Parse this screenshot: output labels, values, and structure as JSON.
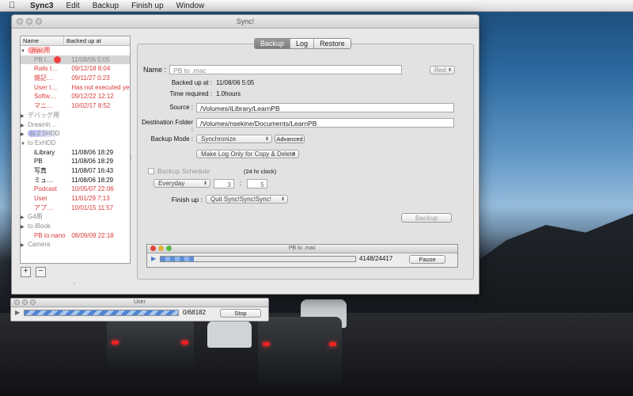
{
  "menubar": {
    "app": "Sync3",
    "items": [
      "Edit",
      "Backup",
      "Finish up",
      "Window"
    ]
  },
  "window": {
    "title": "Sync!"
  },
  "list": {
    "columns": [
      "Name",
      "Backed up at"
    ],
    "rows": [
      {
        "name": ".mac用",
        "date": "",
        "group": true,
        "expanded": true,
        "style": "red",
        "hl": "red"
      },
      {
        "name": "PB t…",
        "date": "11/08/06 5:05",
        "style": "gray",
        "sel": true,
        "dot": true
      },
      {
        "name": "Rails t…",
        "date": "09/12/18 8:04",
        "style": "red"
      },
      {
        "name": "雑記…",
        "date": "09/11/27 0:23",
        "style": "red"
      },
      {
        "name": "User t…",
        "date": "Has not executed yet",
        "style": "red"
      },
      {
        "name": "Softw…",
        "date": "09/12/22 12:12",
        "style": "red"
      },
      {
        "name": "マニ…",
        "date": "10/02/17 8:52",
        "style": "red"
      },
      {
        "name": "デバッグ用",
        "date": "",
        "group": true,
        "expanded": false,
        "style": "gray"
      },
      {
        "name": "Dreamh…",
        "date": "",
        "group": true,
        "expanded": false,
        "style": "gray"
      },
      {
        "name": "to 2.5HDD",
        "date": "",
        "group": true,
        "expanded": false,
        "style": "gray",
        "hl": "blue"
      },
      {
        "name": "to ExHDD",
        "date": "",
        "group": true,
        "expanded": true,
        "style": "gray"
      },
      {
        "name": "iLibrary",
        "date": "11/08/06 18:29",
        "style": "dark"
      },
      {
        "name": "PB",
        "date": "11/08/06 18:29",
        "style": "dark"
      },
      {
        "name": "写真",
        "date": "11/08/07 16:43",
        "style": "dark"
      },
      {
        "name": "ミュ…",
        "date": "11/08/06 18:29",
        "style": "dark"
      },
      {
        "name": "Podcast",
        "date": "10/05/07 22:06",
        "style": "red"
      },
      {
        "name": "User",
        "date": "11/01/29 7:13",
        "style": "red"
      },
      {
        "name": "アプ…",
        "date": "10/01/15 11:57",
        "style": "red"
      },
      {
        "name": "G4用",
        "date": "",
        "group": true,
        "expanded": false,
        "style": "gray"
      },
      {
        "name": "to iBook",
        "date": "",
        "group": true,
        "expanded": false,
        "style": "gray"
      },
      {
        "name": "PB to nano",
        "date": "08/09/09 22:18",
        "style": "red"
      },
      {
        "name": "Camera",
        "date": "",
        "group": true,
        "expanded": false,
        "style": "gray"
      }
    ],
    "add_label": "+",
    "remove_label": "−"
  },
  "tabs": [
    {
      "label": "Backup",
      "active": true
    },
    {
      "label": "Log"
    },
    {
      "label": "Restore"
    }
  ],
  "form": {
    "name_label": "Name :",
    "name_value": "PB to .mac",
    "color_value": "Red",
    "backed_up_label": "Backed up at :",
    "backed_up_value": "11/08/06 5:05",
    "time_required_label": "Time required :",
    "time_required_value": "1.0hours",
    "source_label": "Source :",
    "source_value": "/Volumes/iLibrary/LearnPB",
    "dest_label": "Destination Folder :",
    "dest_value": "/Volumes/nsekine/Documents/LearnPB",
    "mode_label": "Backup Mode :",
    "mode_value": "Synchronize",
    "advanced_label": "Advanced",
    "log_option": "Make Log Only for Copy & Delete",
    "schedule_label": "Backup Schedule",
    "clock_label": "(24 hr clock)",
    "schedule_value": "Everyday",
    "hour": "3",
    "colon": ":",
    "minute": "5",
    "finish_label": "Finish up :",
    "finish_value": "Quit Sync!Sync!Sync!",
    "backup_button": "Backup"
  },
  "progress_main": {
    "title": "PB to .mac",
    "count": "4148/24417",
    "button": "Pause",
    "fraction": 0.17
  },
  "progress_user": {
    "title": "User",
    "count": "0/68182",
    "button": "Stop",
    "fraction": 1.0
  },
  "colors": {
    "accent": "#4e84d1",
    "warning": "#d93a3a"
  }
}
